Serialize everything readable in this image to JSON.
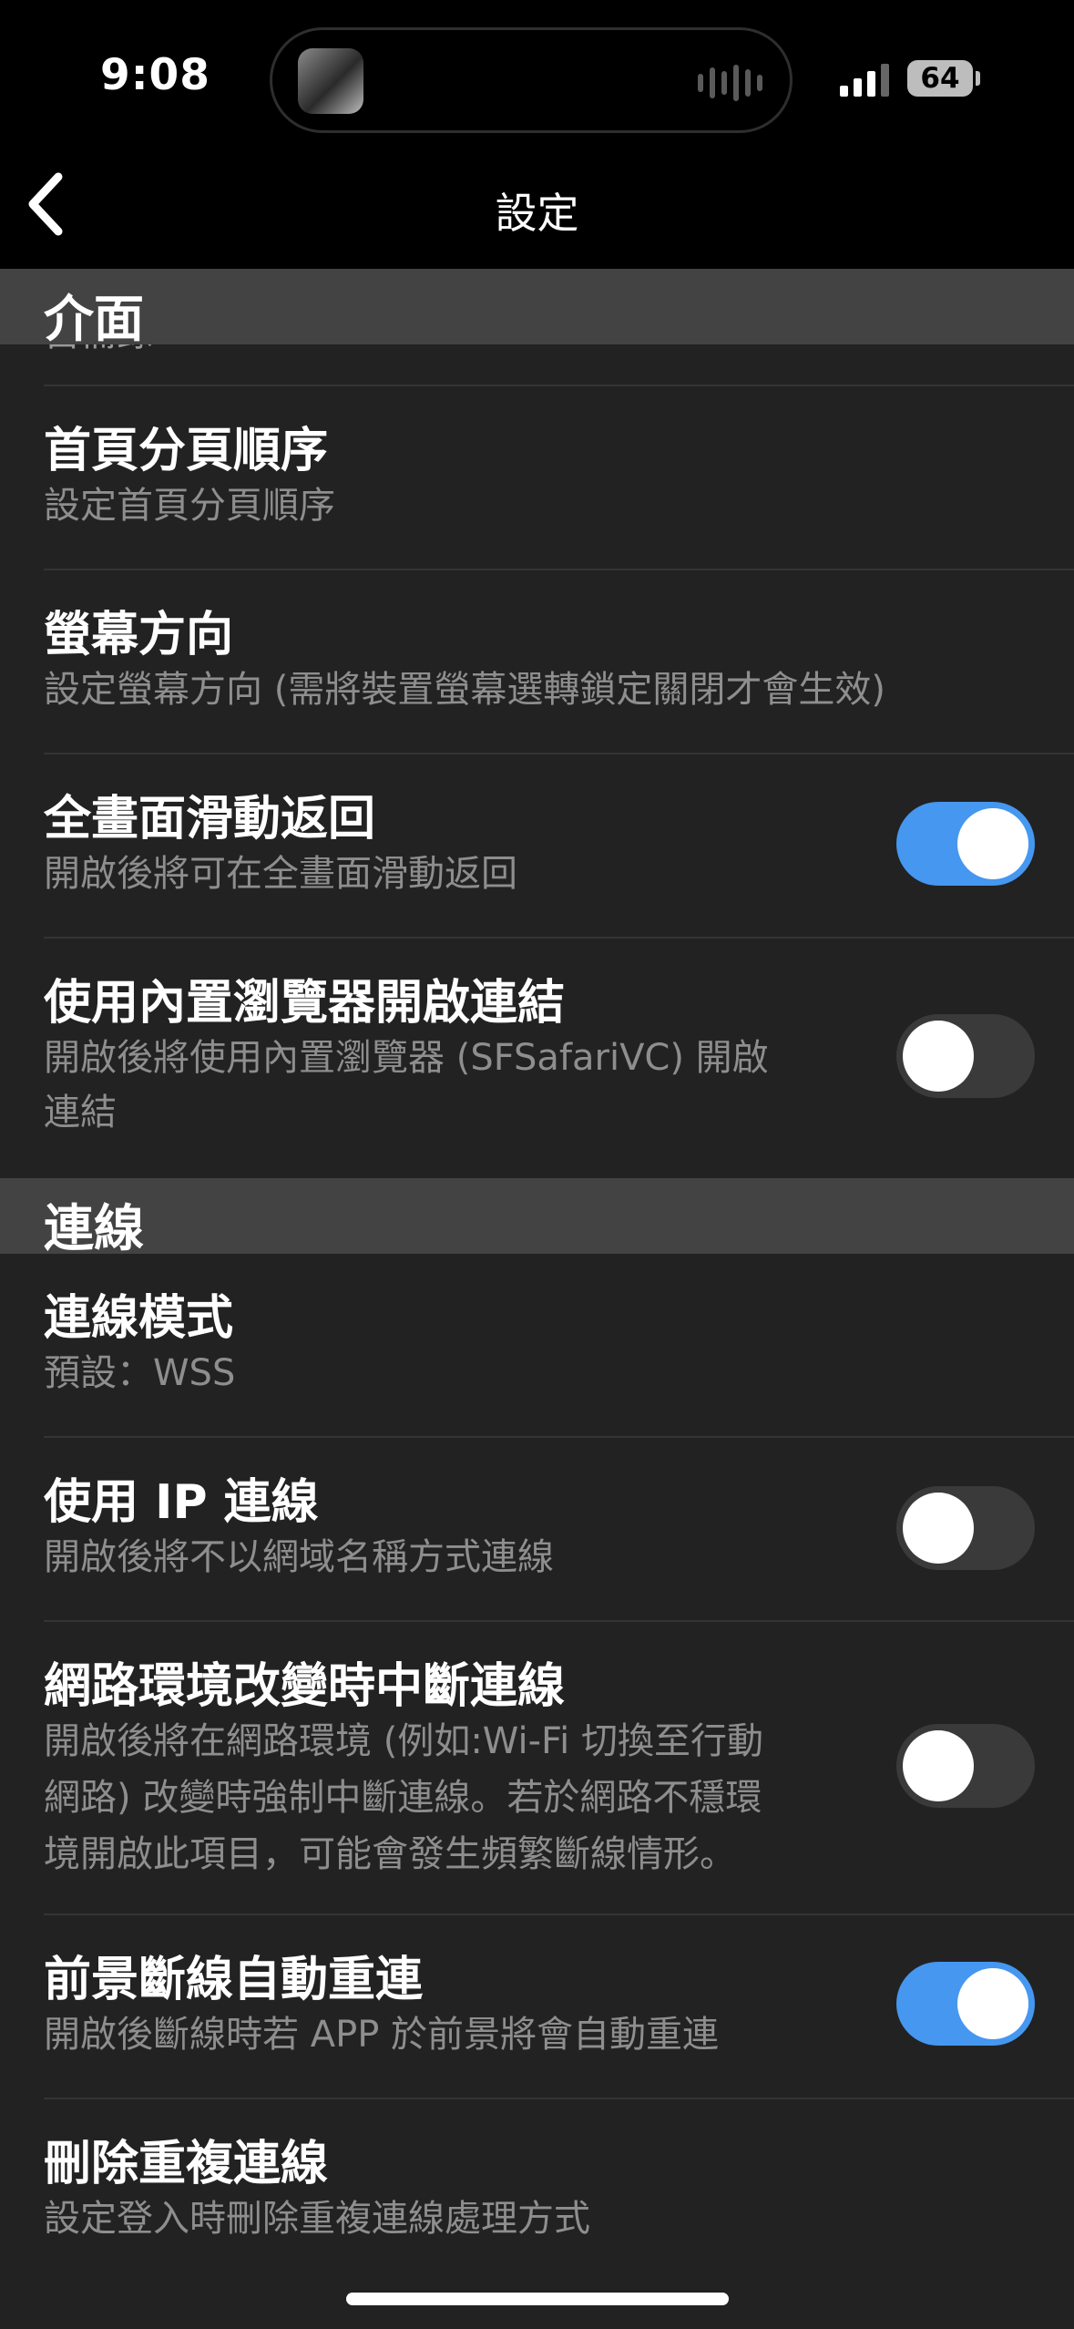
{
  "status": {
    "time": "9:08",
    "battery": "64"
  },
  "nav": {
    "title": "設定"
  },
  "sections": {
    "interface": {
      "header": "介面",
      "partial": "自備錄"
    },
    "connection": {
      "header": "連線"
    }
  },
  "items": {
    "tab_order": {
      "title": "首頁分頁順序",
      "sub": "設定首頁分頁順序"
    },
    "orientation": {
      "title": "螢幕方向",
      "sub": "設定螢幕方向 (需將裝置螢幕選轉鎖定關閉才會生效)"
    },
    "swipe_back": {
      "title": "全畫面滑動返回",
      "sub": "開啟後將可在全畫面滑動返回",
      "enabled": true
    },
    "builtin_browser": {
      "title": "使用內置瀏覽器開啟連結",
      "sub1": "開啟後將使用內置瀏覽器 (SFSafariVC) 開啟",
      "sub2": "連結",
      "enabled": false
    },
    "conn_mode": {
      "title": "連線模式",
      "sub": "預設：WSS"
    },
    "use_ip": {
      "title": "使用 IP 連線",
      "sub": "開啟後將不以網域名稱方式連線",
      "enabled": false
    },
    "net_change": {
      "title": "網路環境改變時中斷連線",
      "sub1": "開啟後將在網路環境 (例如:Wi-Fi 切換至行動",
      "sub2": "網路) 改變時強制中斷連線。若於網路不穩環",
      "sub3": "境開啟此項目，可能會發生頻繁斷線情形。",
      "enabled": false
    },
    "auto_reconnect": {
      "title": "前景斷線自動重連",
      "sub": "開啟後斷線時若 APP 於前景將會自動重連",
      "enabled": true
    },
    "dup_conn": {
      "title": "刪除重複連線",
      "sub": "設定登入時刪除重複連線處理方式"
    }
  },
  "colors": {
    "toggle_on": "#4597f0",
    "toggle_off": "#3a3a3a",
    "section_bg": "#434343",
    "page_bg": "#222222"
  }
}
